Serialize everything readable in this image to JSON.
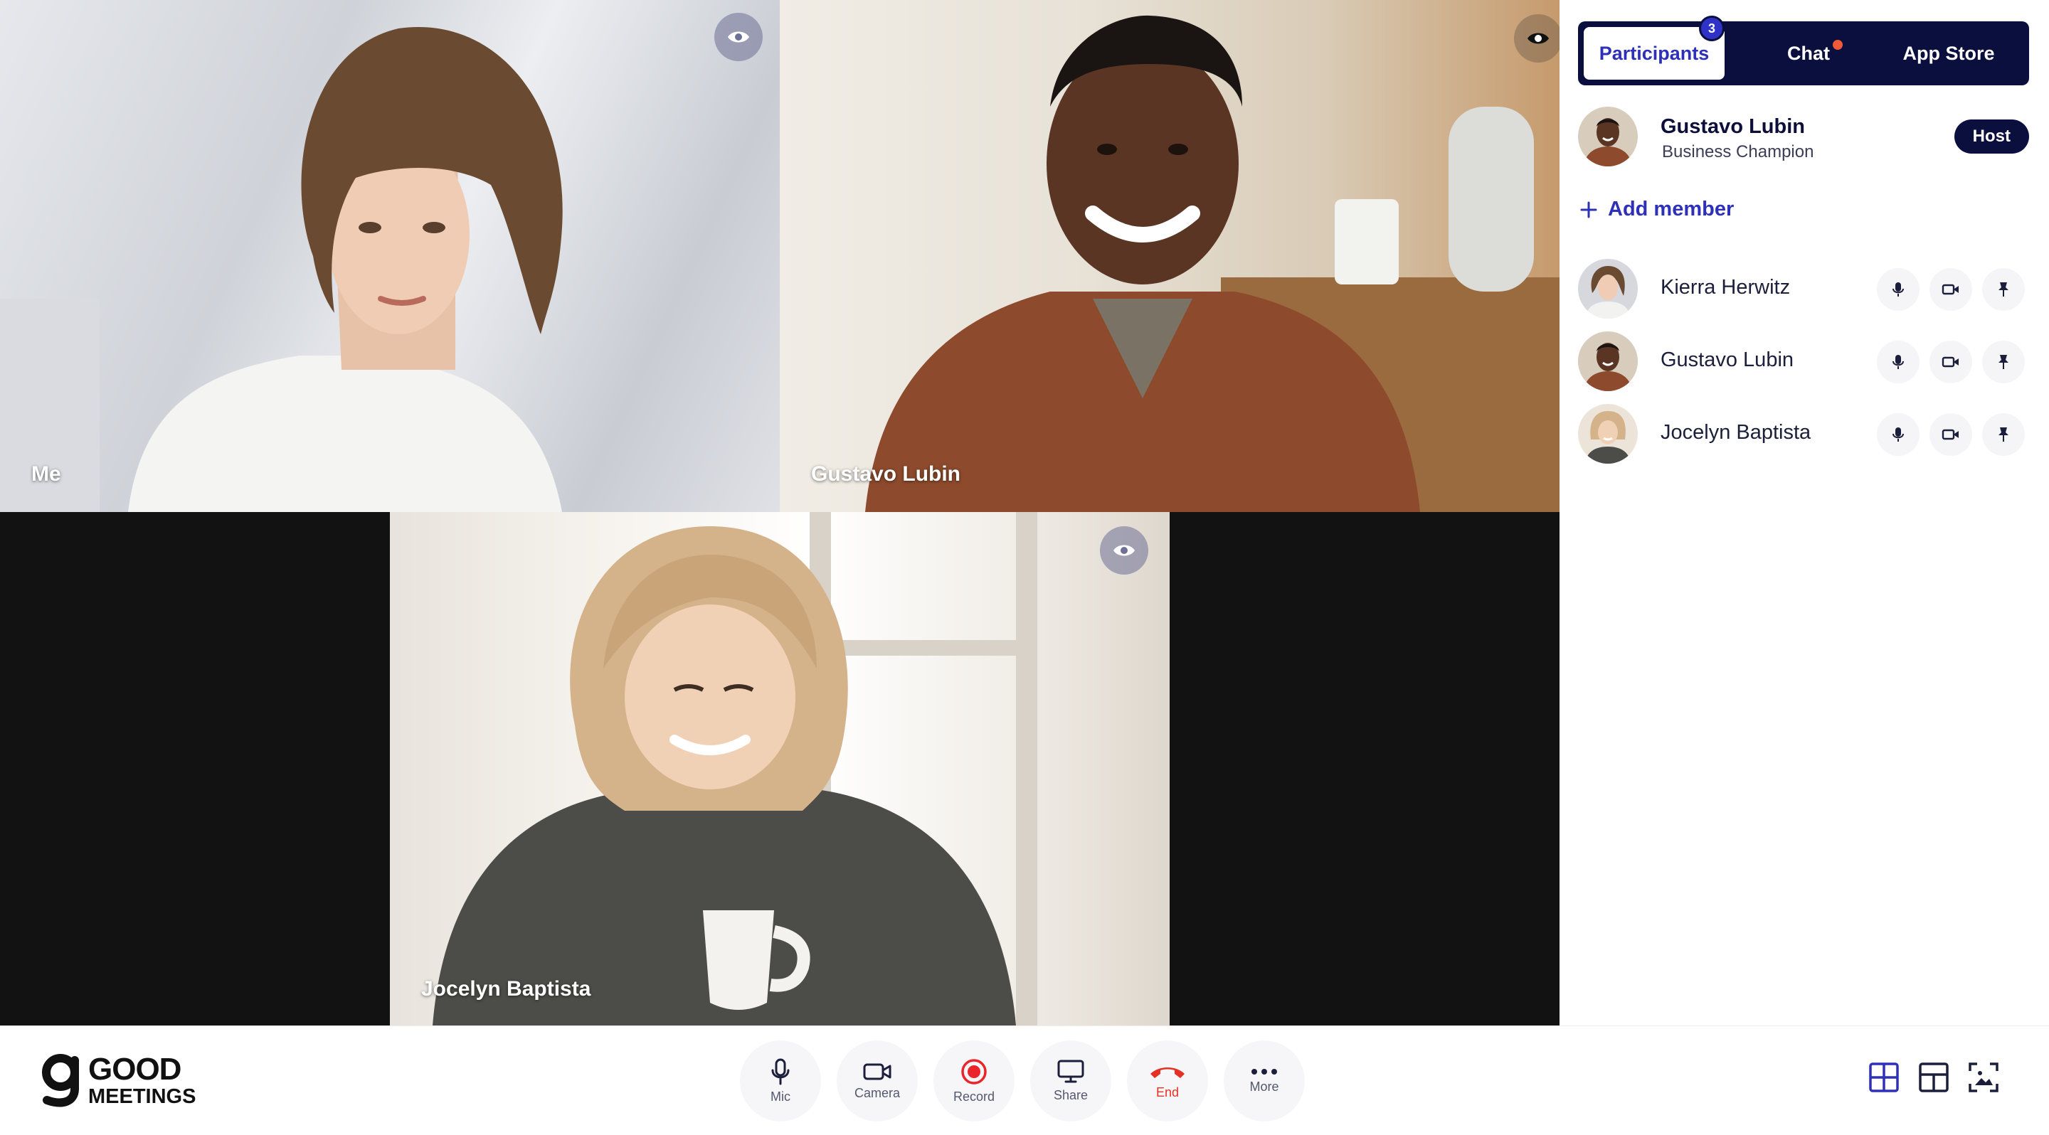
{
  "tiles": [
    {
      "name": "Me"
    },
    {
      "name": "Gustavo Lubin"
    },
    {
      "name": "Jocelyn Baptista"
    }
  ],
  "sidebar": {
    "tabs": [
      {
        "label": "Participants",
        "badge": "3",
        "active": true
      },
      {
        "label": "Chat",
        "unread_dot": true
      },
      {
        "label": "App Store"
      }
    ],
    "host": {
      "name": "Gustavo Lubin",
      "subtitle": "Business Champion",
      "badge": "Host"
    },
    "add_member_label": "Add member",
    "members": [
      {
        "name": "Kierra Herwitz"
      },
      {
        "name": "Gustavo Lubin"
      },
      {
        "name": "Jocelyn Baptista"
      }
    ]
  },
  "toolbar": {
    "logo_line1": "GOOD",
    "logo_line2": "MEETINGS",
    "buttons": [
      {
        "label": "Mic",
        "icon": "mic-icon"
      },
      {
        "label": "Camera",
        "icon": "camera-icon"
      },
      {
        "label": "Record",
        "icon": "record-icon"
      },
      {
        "label": "Share",
        "icon": "share-screen-icon"
      },
      {
        "label": "End",
        "icon": "end-call-icon"
      },
      {
        "label": "More",
        "icon": "more-icon"
      }
    ],
    "layout_icons": [
      "grid-layout-icon",
      "split-layout-icon",
      "focus-layout-icon"
    ]
  },
  "colors": {
    "accent": "#2e31b8",
    "navy": "#0b0f3e",
    "end_red": "#e53125",
    "record_red": "#e9242a",
    "notification": "#f05a3a"
  }
}
